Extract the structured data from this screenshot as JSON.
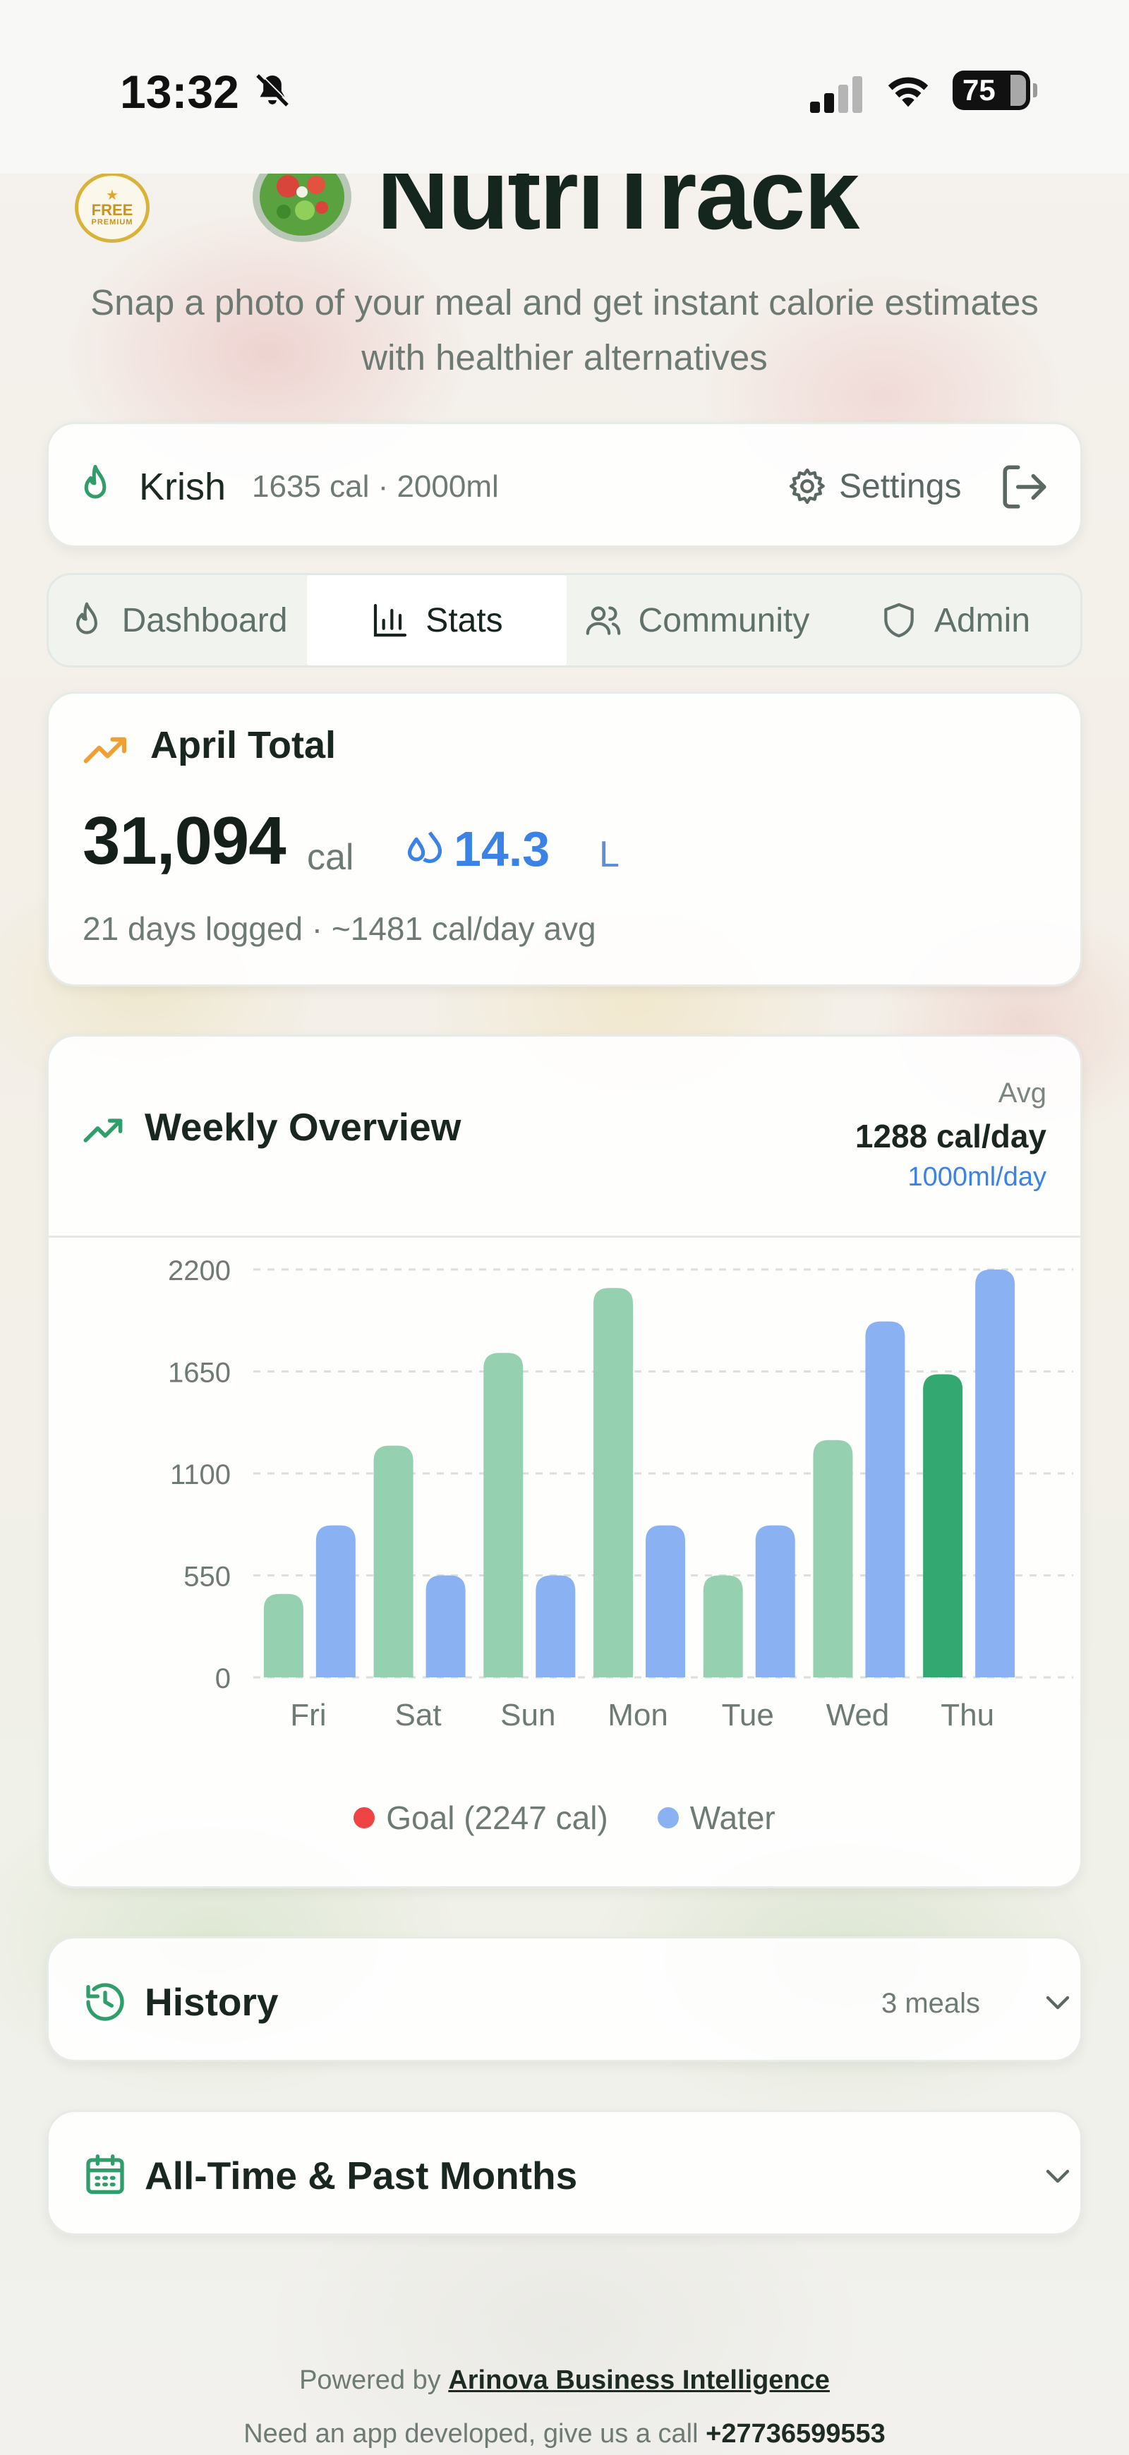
{
  "status_bar": {
    "time": "13:32",
    "battery": "75",
    "icons": [
      "bell-off-icon",
      "signal-icon",
      "wifi-icon",
      "battery-icon"
    ]
  },
  "header": {
    "badge": {
      "free": "FREE",
      "premium": "PREMIUM"
    },
    "app_title": "NutriTrack",
    "tagline": "Snap a photo of your meal and get instant calorie estimates with healthier alternatives"
  },
  "user_bar": {
    "name": "Krish",
    "meta": "1635 cal · 2000ml",
    "settings_label": "Settings"
  },
  "tabs": [
    {
      "label": "Dashboard",
      "icon": "flame-icon",
      "active": false
    },
    {
      "label": "Stats",
      "icon": "bar-chart-icon",
      "active": true
    },
    {
      "label": "Community",
      "icon": "users-icon",
      "active": false
    },
    {
      "label": "Admin",
      "icon": "shield-icon",
      "active": false
    }
  ],
  "month_total": {
    "title": "April Total",
    "calories": "31,094",
    "calories_unit": "cal",
    "water": "14.3",
    "water_unit": "L",
    "summary": "21 days logged · ~1481 cal/day avg"
  },
  "weekly": {
    "title": "Weekly Overview",
    "avg_label": "Avg",
    "avg_cal": "1288 cal/day",
    "avg_water": "1000ml/day"
  },
  "chart_data": {
    "type": "bar",
    "categories": [
      "Fri",
      "Sat",
      "Sun",
      "Mon",
      "Tue",
      "Wed",
      "Thu"
    ],
    "series": [
      {
        "name": "Calories",
        "values": [
          450,
          1250,
          1750,
          2100,
          550,
          1280,
          1635
        ]
      },
      {
        "name": "Water",
        "values": [
          820,
          550,
          550,
          820,
          820,
          1920,
          2200
        ]
      }
    ],
    "y_ticks": [
      0,
      550,
      1100,
      1650,
      2200
    ],
    "ylim": [
      0,
      2200
    ],
    "grid": true,
    "highlight_index": 6,
    "legend": [
      {
        "label": "Goal (2247 cal)",
        "color": "#ef4444"
      },
      {
        "label": "Water",
        "color": "#8ab2f2"
      }
    ],
    "colors": {
      "calories": "#95d1b1",
      "calories_today": "#33a871",
      "water": "#8ab2f2"
    }
  },
  "history": {
    "title": "History",
    "count": "3 meals"
  },
  "all_time": {
    "title": "All-Time & Past Months"
  },
  "footer": {
    "powered_prefix": "Powered by",
    "powered_link": "Arinova Business Intelligence",
    "call_prefix": "Need an app developed, give us a call",
    "phone": "+27736599553"
  },
  "colors": {
    "brand_green": "#2f9e6a",
    "accent_blue": "#3b82e6",
    "trend_orange": "#f0a030"
  }
}
